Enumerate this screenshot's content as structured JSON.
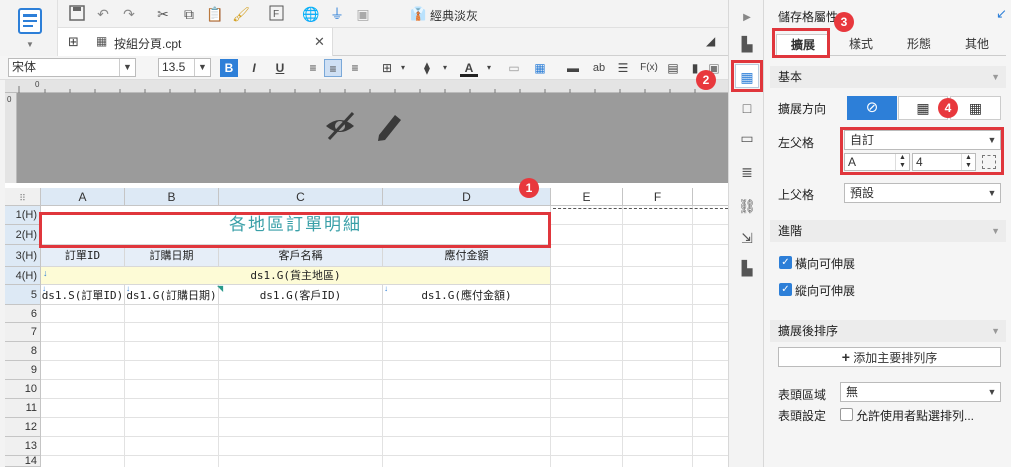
{
  "toolbar": {
    "style_label": "經典淡灰"
  },
  "tab": {
    "label": "按組分頁.cpt"
  },
  "format_bar": {
    "font_name": "宋体",
    "font_size": "13.5",
    "bold": "B",
    "italic": "I",
    "underline": "U",
    "ab": "ab",
    "fx": "F(x)"
  },
  "ruler": {
    "zero": "0",
    "vzero": "0"
  },
  "grid": {
    "columns": [
      "A",
      "B",
      "C",
      "D",
      "E",
      "F"
    ],
    "rows": [
      "1(H)",
      "2(H)",
      "3(H)",
      "4(H)",
      "5",
      "6",
      "7",
      "8",
      "9",
      "10",
      "11",
      "12",
      "13",
      "14"
    ],
    "title": "各地區訂單明細",
    "headers": [
      "訂單ID",
      "訂購日期",
      "客戶名稱",
      "應付金額"
    ],
    "group_row": "ds1.G(貨主地區)",
    "detail": [
      "ds1.S(訂單ID)",
      "ds1.G(訂購日期)",
      "ds1.G(客戶ID)",
      "ds1.G(應付金額)"
    ]
  },
  "panel": {
    "title": "儲存格屬性",
    "tabs": [
      "擴展",
      "樣式",
      "形態",
      "其他"
    ],
    "basic": "基本",
    "expand_dir": "擴展方向",
    "left_parent": "左父格",
    "left_parent_value": "自訂",
    "left_col": "A",
    "left_row": "4",
    "up_parent": "上父格",
    "up_parent_value": "預設",
    "advanced": "進階",
    "h_extend": "橫向可伸展",
    "v_extend": "縱向可伸展",
    "sort_section": "擴展後排序",
    "add_sort": "添加主要排列序",
    "header_area": "表頭區域",
    "header_area_value": "無",
    "header_setting": "表頭設定",
    "allow_sort": "允許使用者點選排列..."
  },
  "badges": [
    "1",
    "2",
    "3",
    "4"
  ],
  "colors": {
    "accent": "#2d7fd8",
    "red": "#e0363c",
    "title_text": "#3aa0a8"
  }
}
